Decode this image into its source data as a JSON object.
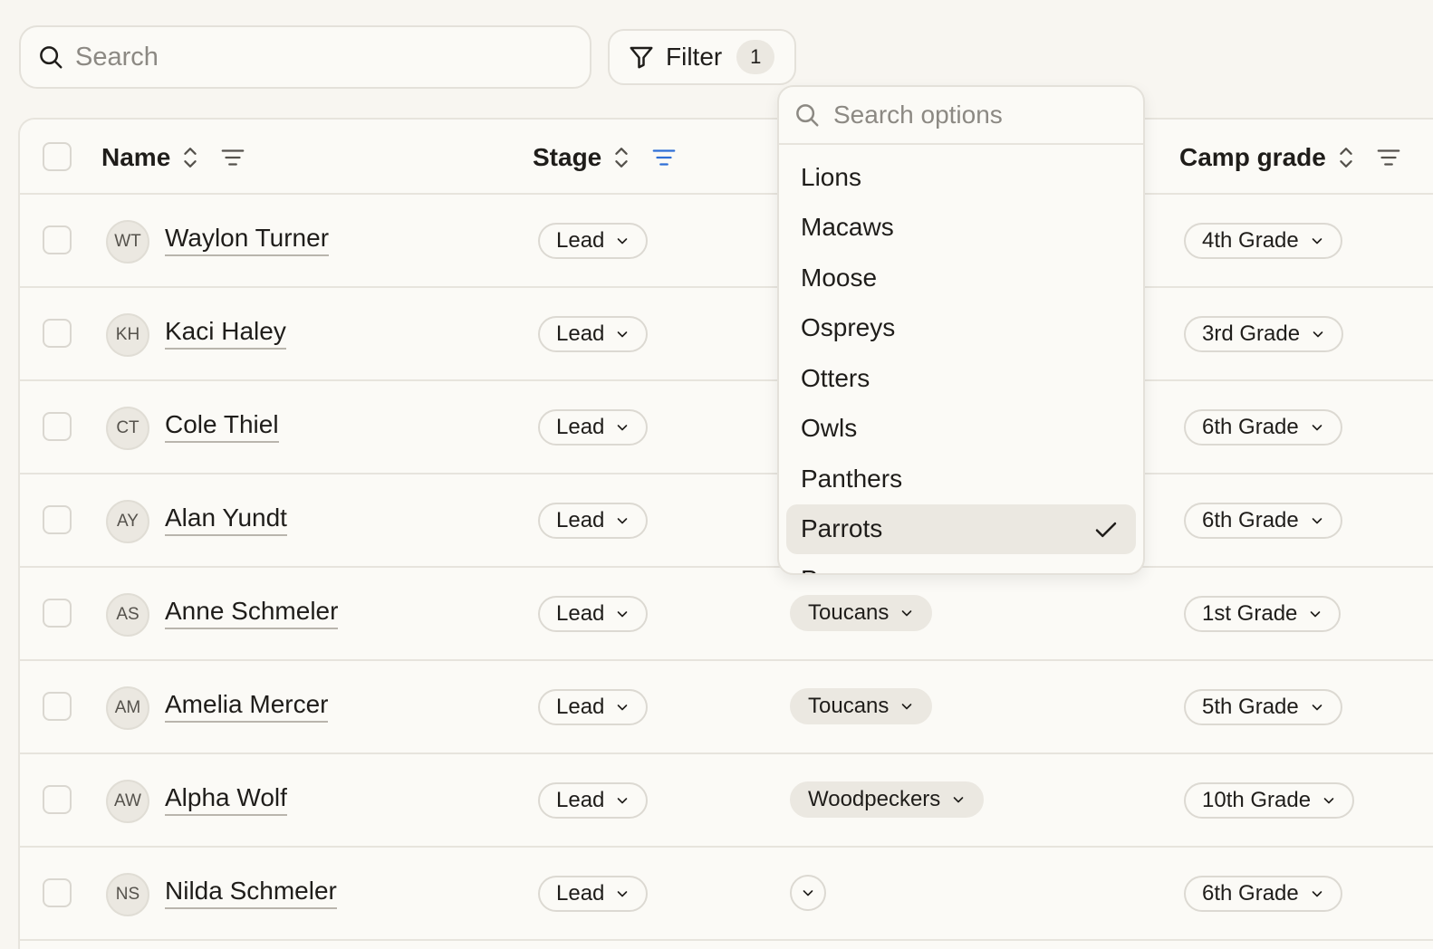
{
  "search": {
    "placeholder": "Search"
  },
  "filter": {
    "label": "Filter",
    "count": "1"
  },
  "columns": {
    "name": "Name",
    "stage": "Stage",
    "camp_grade": "Camp grade"
  },
  "rows": [
    {
      "initials": "WT",
      "name": "Waylon Turner",
      "stage": "Lead",
      "cabin": "",
      "grade": "4th Grade"
    },
    {
      "initials": "KH",
      "name": "Kaci Haley",
      "stage": "Lead",
      "cabin": "",
      "grade": "3rd Grade"
    },
    {
      "initials": "CT",
      "name": "Cole Thiel",
      "stage": "Lead",
      "cabin": "",
      "grade": "6th Grade"
    },
    {
      "initials": "AY",
      "name": "Alan Yundt",
      "stage": "Lead",
      "cabin": "",
      "grade": "6th Grade"
    },
    {
      "initials": "AS",
      "name": "Anne Schmeler",
      "stage": "Lead",
      "cabin": "Toucans",
      "grade": "1st Grade"
    },
    {
      "initials": "AM",
      "name": "Amelia Mercer",
      "stage": "Lead",
      "cabin": "Toucans",
      "grade": "5th Grade"
    },
    {
      "initials": "AW",
      "name": "Alpha Wolf",
      "stage": "Lead",
      "cabin": "Woodpeckers",
      "grade": "10th Grade"
    },
    {
      "initials": "NS",
      "name": "Nilda Schmeler",
      "stage": "Lead",
      "cabin": "",
      "grade": "6th Grade"
    }
  ],
  "dropdown": {
    "placeholder": "Search options",
    "options": [
      "Lions",
      "Macaws",
      "Moose",
      "Ospreys",
      "Otters",
      "Owls",
      "Panthers",
      "Parrots",
      "Pumas"
    ],
    "selected": "Parrots"
  },
  "colors": {
    "accent": "#2f6fd6",
    "background": "#f8f6f1",
    "pill": "#ebe8e1"
  }
}
